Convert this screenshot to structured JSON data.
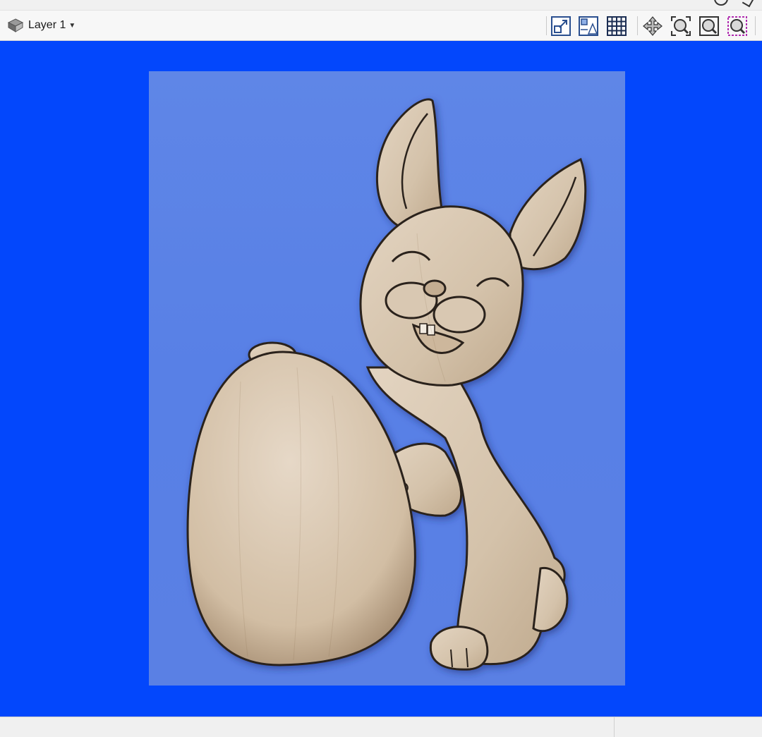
{
  "toolbar": {
    "layer_label": "Layer 1",
    "buttons": [
      {
        "name": "scale-icon"
      },
      {
        "name": "align-icon"
      },
      {
        "name": "grid-icon"
      },
      {
        "name": "move-icon"
      },
      {
        "name": "zoom-all-icon"
      },
      {
        "name": "zoom-fit-icon"
      },
      {
        "name": "zoom-selection-icon"
      }
    ]
  },
  "viewport": {
    "background_color": "#0347fc",
    "panel_color": "#5a82e6",
    "model_color": "#d8c7b1"
  }
}
